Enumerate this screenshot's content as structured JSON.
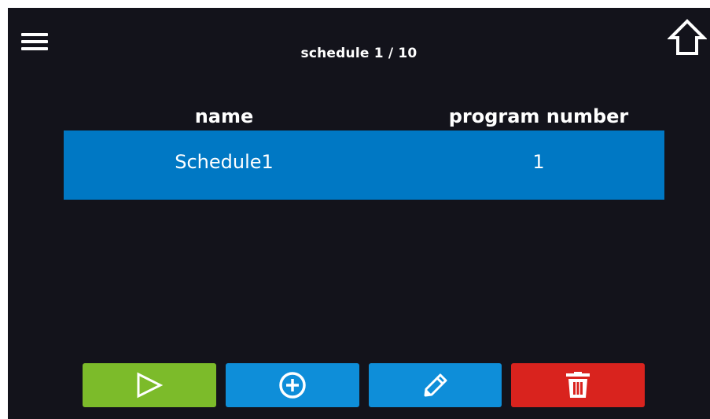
{
  "header": {
    "title": "schedule 1 / 10",
    "menu_icon": "hamburger-menu-icon",
    "home_icon": "home-icon"
  },
  "table": {
    "columns": [
      "name",
      "program number"
    ],
    "rows": [
      {
        "name": "Schedule1",
        "program_number": "1",
        "selected": true
      }
    ]
  },
  "toolbar": {
    "buttons": [
      {
        "action": "run",
        "icon": "play-icon",
        "color": "#7cbb2a"
      },
      {
        "action": "add",
        "icon": "plus-circle-icon",
        "color": "#0e8ed9"
      },
      {
        "action": "edit",
        "icon": "pencil-icon",
        "color": "#0e8ed9"
      },
      {
        "action": "delete",
        "icon": "trash-icon",
        "color": "#d9231e"
      }
    ]
  },
  "colors": {
    "background": "#13131b",
    "selected_row": "#0078c4",
    "text": "#ffffff"
  }
}
